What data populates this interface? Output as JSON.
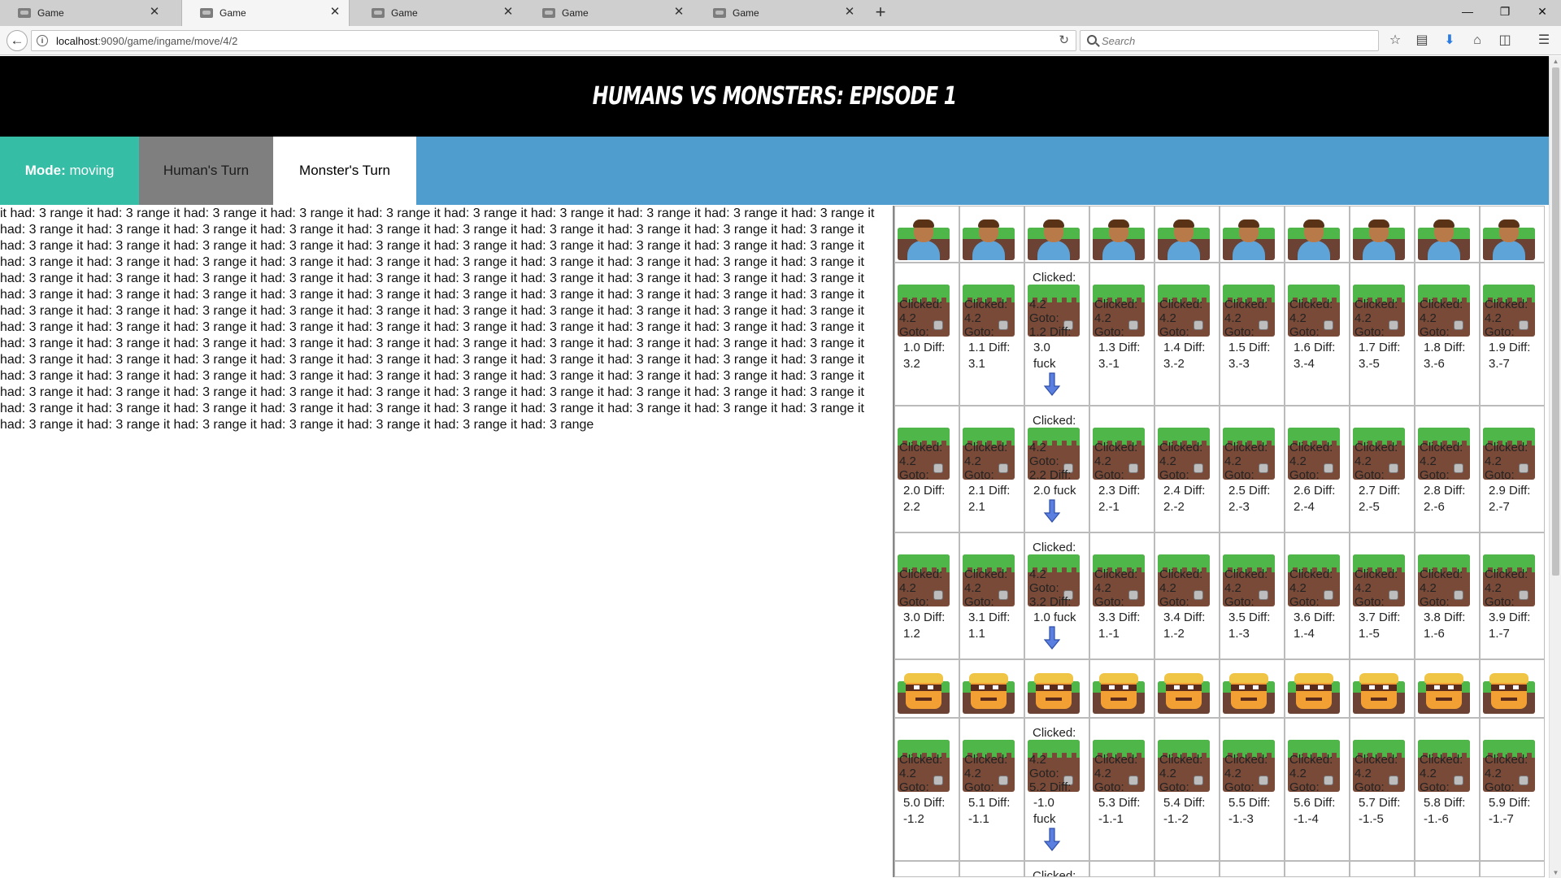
{
  "browser": {
    "tabs": [
      "Game",
      "Game",
      "Game",
      "Game",
      "Game"
    ],
    "active_tab": 1,
    "url_host": "localhost",
    "url_path": ":9090/game/ingame/move/4/2",
    "search_placeholder": "Search"
  },
  "banner": {
    "title": "HUMANS VS MONSTERS: EPISODE 1"
  },
  "menu": {
    "mode_label": "Mode:",
    "mode_value": "moving",
    "human_turn": "Human's Turn",
    "monster_turn": "Monster's Turn"
  },
  "log": {
    "text": "it had: 3 range it had: 3 range it had: 3 range it had: 3 range it had: 3 range it had: 3 range it had: 3 range it had: 3 range it had: 3 range it had: 3 range it had: 3 range it had: 3 range it had: 3 range it had: 3 range it had: 3 range it had: 3 range it had: 3 range it had: 3 range it had: 3 range it had: 3 range it had: 3 range it had: 3 range it had: 3 range it had: 3 range it had: 3 range it had: 3 range it had: 3 range it had: 3 range it had: 3 range it had: 3 range it had: 3 range it had: 3 range it had: 3 range it had: 3 range it had: 3 range it had: 3 range it had: 3 range it had: 3 range it had: 3 range it had: 3 range it had: 3 range it had: 3 range it had: 3 range it had: 3 range it had: 3 range it had: 3 range it had: 3 range it had: 3 range it had: 3 range it had: 3 range it had: 3 range it had: 3 range it had: 3 range it had: 3 range it had: 3 range it had: 3 range it had: 3 range it had: 3 range it had: 3 range it had: 3 range it had: 3 range it had: 3 range it had: 3 range it had: 3 range it had: 3 range it had: 3 range it had: 3 range it had: 3 range it had: 3 range it had: 3 range it had: 3 range it had: 3 range it had: 3 range it had: 3 range it had: 3 range it had: 3 range it had: 3 range it had: 3 range it had: 3 range it had: 3 range it had: 3 range it had: 3 range it had: 3 range it had: 3 range it had: 3 range it had: 3 range it had: 3 range it had: 3 range it had: 3 range it had: 3 range it had: 3 range it had: 3 range it had: 3 range it had: 3 range it had: 3 range it had: 3 range it had: 3 range it had: 3 range it had: 3 range it had: 3 range it had: 3 range it had: 3 range it had: 3 range it had: 3 range it had: 3 range it had: 3 range it had: 3 range it had: 3 range it had: 3 range it had: 3 range it had: 3 range it had: 3 range it had: 3 range it had: 3 range it had: 3 range it had: 3 range it had: 3 range it had: 3 range it had: 3 range it had: 3 range it had: 3 range it had: 3 range it had: 3 range it had: 3 range it had: 3 range it had: 3 range it had: 3 range it had: 3 range it had: 3 range it had: 3 range it had: 3 range it had: 3 range it had: 3 range it had: 3 range it had: 3 range it had: 3 range it had: 3 range"
  },
  "board": {
    "rows": [
      {
        "kind": "humans",
        "count": 10
      },
      {
        "kind": "tiles",
        "overlay": "Clicked:\n4.2\nGoto:",
        "selected_col": 2,
        "selected_top": "Clicked:",
        "selected_overlay": "4.2\nGoto:\n1.2 Diff:",
        "captions": [
          "1.0 Diff:\n3.2",
          "1.1 Diff:\n3.1",
          "3.0\nfuck",
          "1.3 Diff:\n3.-1",
          "1.4 Diff:\n3.-2",
          "1.5 Diff:\n3.-3",
          "1.6 Diff:\n3.-4",
          "1.7 Diff:\n3.-5",
          "1.8 Diff:\n3.-6",
          "1.9 Diff:\n3.-7"
        ]
      },
      {
        "kind": "tiles",
        "overlay": "Clicked:\n4.2\nGoto:",
        "selected_col": 2,
        "selected_top": "Clicked:",
        "selected_overlay": "4.2\nGoto:\n2.2 Diff:",
        "captions": [
          "2.0 Diff:\n2.2",
          "2.1 Diff:\n2.1",
          "2.0 fuck",
          "2.3 Diff:\n2.-1",
          "2.4 Diff:\n2.-2",
          "2.5 Diff:\n2.-3",
          "2.6 Diff:\n2.-4",
          "2.7 Diff:\n2.-5",
          "2.8 Diff:\n2.-6",
          "2.9 Diff:\n2.-7"
        ]
      },
      {
        "kind": "tiles",
        "overlay": "Clicked:\n4.2\nGoto:",
        "selected_col": 2,
        "selected_top": "Clicked:",
        "selected_overlay": "4.2\nGoto:\n3.2 Diff:",
        "captions": [
          "3.0 Diff:\n1.2",
          "3.1 Diff:\n1.1",
          "1.0 fuck",
          "3.3 Diff:\n1.-1",
          "3.4 Diff:\n1.-2",
          "3.5 Diff:\n1.-3",
          "3.6 Diff:\n1.-4",
          "3.7 Diff:\n1.-5",
          "3.8 Diff:\n1.-6",
          "3.9 Diff:\n1.-7"
        ]
      },
      {
        "kind": "monsters",
        "count": 10
      },
      {
        "kind": "tiles",
        "overlay": "Clicked:\n4.2\nGoto:",
        "selected_col": 2,
        "selected_top": "Clicked:",
        "selected_overlay": "4.2\nGoto:\n5.2 Diff:",
        "captions": [
          "5.0 Diff:\n-1.2",
          "5.1 Diff:\n-1.1",
          "-1.0\nfuck",
          "5.3 Diff:\n-1.-1",
          "5.4 Diff:\n-1.-2",
          "5.5 Diff:\n-1.-3",
          "5.6 Diff:\n-1.-4",
          "5.7 Diff:\n-1.-5",
          "5.8 Diff:\n-1.-6",
          "5.9 Diff:\n-1.-7"
        ]
      },
      {
        "kind": "partial",
        "selected_col": 2,
        "selected_top": "Clicked:"
      }
    ]
  },
  "colors": {
    "mode_bg": "#35bda5",
    "human_turn_bg": "#7f7f7f",
    "menu_bg": "#4e9dce",
    "banner_bg": "#000000",
    "arrow": "#5b7fe0"
  }
}
